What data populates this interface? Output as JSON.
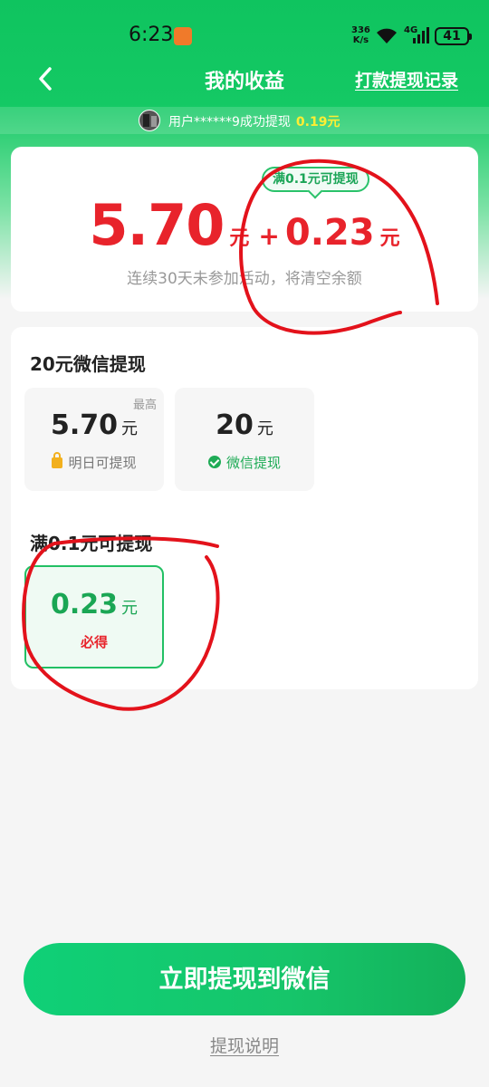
{
  "status_bar": {
    "time": "6:23",
    "net_speed_value": "336",
    "net_speed_unit": "K/s",
    "network_type": "4G",
    "battery": "41"
  },
  "nav": {
    "title": "我的收益",
    "record_link": "打款提现记录"
  },
  "ticker": {
    "text": "用户******9成功提现",
    "amount": "0.19元"
  },
  "balance": {
    "tip": "满0.1元可提现",
    "main_amount": "5.70",
    "main_unit": "元",
    "plus": "+",
    "extra_amount": "0.23",
    "extra_unit": "元",
    "note": "连续30天未参加活动，将清空余额"
  },
  "section_wechat": {
    "title": "20元微信提现",
    "options": [
      {
        "tag": "最高",
        "amount": "5.70",
        "unit": "元",
        "sub": "明日可提现",
        "icon": "lock-icon"
      },
      {
        "tag": "",
        "amount": "20",
        "unit": "元",
        "sub": "微信提现",
        "icon": "wechat-check-icon"
      }
    ]
  },
  "section_min": {
    "title": "满0.1元可提现",
    "option": {
      "amount": "0.23",
      "unit": "元",
      "sub": "必得"
    }
  },
  "cta": {
    "label": "立即提现到微信"
  },
  "footer": {
    "explain_link": "提现说明"
  },
  "colors": {
    "brand_green": "#14c964",
    "amount_red": "#e8232b",
    "annotation_red": "#e3121b"
  }
}
